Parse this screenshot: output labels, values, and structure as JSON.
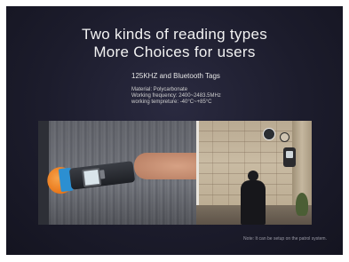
{
  "headline": {
    "line1": "Two kinds of reading types",
    "line2": "More Choices for users"
  },
  "subhead": "125KHZ and Bluetooth Tags",
  "specs": [
    "Material: Polycarbonate",
    "Working frequency: 2400~2483.5MHz",
    "working tempreture: -40°C~+85°C"
  ],
  "note": "Note: It can be setup on the patrol system.",
  "colors": {
    "background": "#1c1c2c",
    "device_accent_orange": "#e87417",
    "device_accent_blue": "#2c8fd1"
  }
}
